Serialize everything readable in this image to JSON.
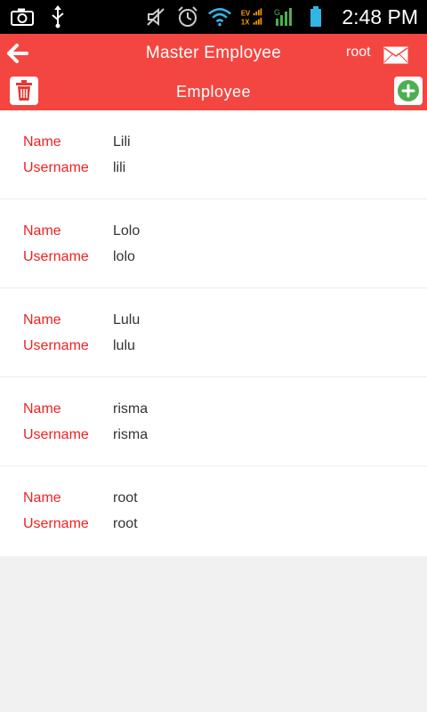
{
  "status_bar": {
    "time": "2:48 PM",
    "icons": [
      "camera-icon",
      "usb-icon",
      "mute-icon",
      "alarm-icon",
      "wifi-icon",
      "ev-signal-icon",
      "signal-icon",
      "battery-icon"
    ]
  },
  "app_bar": {
    "title": "Master Employee",
    "user": "root",
    "subtitle": "Employee"
  },
  "labels": {
    "name": "Name",
    "username": "Username"
  },
  "employees": [
    {
      "name": "Lili",
      "username": "lili"
    },
    {
      "name": "Lolo",
      "username": "lolo"
    },
    {
      "name": "Lulu",
      "username": "lulu"
    },
    {
      "name": "risma",
      "username": "risma"
    },
    {
      "name": "root",
      "username": "root"
    }
  ],
  "colors": {
    "accent": "#f44640",
    "label": "#ee2222",
    "add": "#4caf50"
  }
}
